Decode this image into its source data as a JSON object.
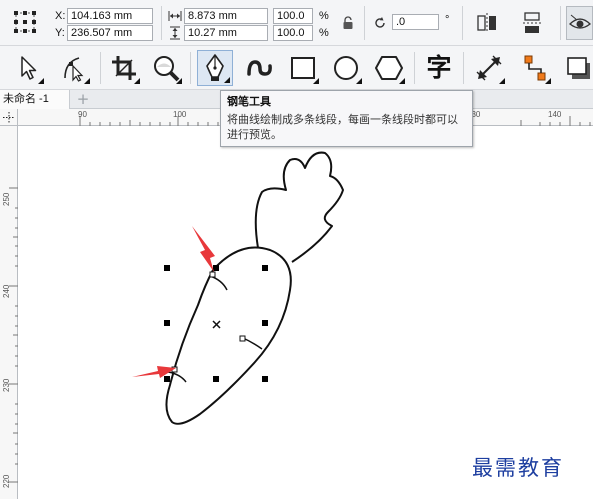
{
  "property_bar": {
    "x_label": "X:",
    "x_value": "104.163 mm",
    "y_label": "Y:",
    "y_value": "236.507 mm",
    "width_value": "8.873 mm",
    "height_value": "10.27 mm",
    "scale_x": "100.0",
    "scale_y": "100.0",
    "percent_x": "%",
    "percent_y": "%",
    "rotation_value": ".0",
    "degree_symbol": "°"
  },
  "toolbox": {
    "tools": [
      {
        "name": "pick-tool",
        "icon": "arrow-pointer-icon"
      },
      {
        "name": "shape-tool",
        "icon": "shape-node-icon"
      },
      {
        "name": "crop-tool",
        "icon": "crop-icon"
      },
      {
        "name": "zoom-tool",
        "icon": "magnifier-icon"
      },
      {
        "name": "pen-tool",
        "icon": "pen-nib-icon",
        "active": true
      },
      {
        "name": "artistic-media-tool",
        "icon": "brush-curve-icon"
      },
      {
        "name": "rectangle-tool",
        "icon": "rectangle-icon"
      },
      {
        "name": "ellipse-tool",
        "icon": "ellipse-icon"
      },
      {
        "name": "polygon-tool",
        "icon": "hexagon-icon"
      },
      {
        "name": "text-tool",
        "icon": "text-char-icon",
        "glyph": "字"
      },
      {
        "name": "dimension-tool",
        "icon": "dimension-arrow-icon"
      },
      {
        "name": "connector-tool",
        "icon": "connector-icon"
      },
      {
        "name": "shadow-tool",
        "icon": "drop-shadow-icon"
      }
    ]
  },
  "tabs": {
    "active_document": "未命名 -1",
    "add_symbol": "+"
  },
  "rulers": {
    "horizontal": [
      "90",
      "100",
      "110",
      "120",
      "130",
      "140"
    ],
    "vertical": [
      "250",
      "240",
      "230",
      "220"
    ],
    "unit_icon": "ruler-origin-icon"
  },
  "tooltip": {
    "title": "钢笔工具",
    "description": "将曲线绘制成多条线段，每画一条线段时都可以进行预览。"
  },
  "watermark": {
    "text": "最需教育"
  },
  "colors": {
    "accent_arrow": "#e8383b",
    "watermark": "#1e3fa0",
    "toolbar_bg": "#f4f5f7",
    "selected_tool_bg": "#dde7f3"
  }
}
